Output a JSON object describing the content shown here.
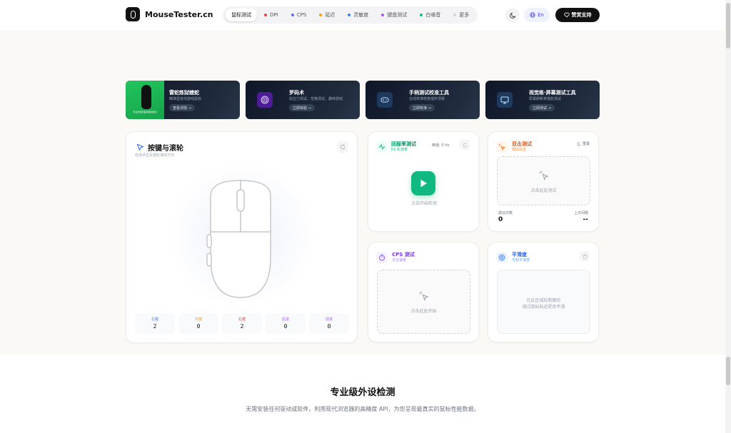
{
  "header": {
    "logo_text": "MouseTester.cn",
    "nav": [
      {
        "label": "鼠标测试",
        "dot": ""
      },
      {
        "label": "DPI",
        "dot": "#ef4444"
      },
      {
        "label": "CPS",
        "dot": "#6366f1"
      },
      {
        "label": "延迟",
        "dot": "#f59e0b"
      },
      {
        "label": "灵敏度",
        "dot": "#3b82f6"
      },
      {
        "label": "键盘测试",
        "dot": "#a855f7"
      },
      {
        "label": "白噪音",
        "dot": "#10b981"
      },
      {
        "label": "更多",
        "dot": "#d1d5db"
      }
    ],
    "lang_label": "En",
    "donate_label": "赞赏支持"
  },
  "promos": [
    {
      "title": "雷蛇炼狱蝰蛇",
      "sub": "精准型有线游戏鼠标",
      "btn": "查看详情 →",
      "caption": "专业玩家的首选游戏鼠标"
    },
    {
      "title": "罗码术",
      "sub": "反应力测试、性格测试、趣味游戏",
      "btn": "立即体验 →",
      "icon": "target-icon"
    },
    {
      "title": "手柄测试校准工具",
      "sub": "在线校准修复摇杆漂移",
      "btn": "立即校准 →",
      "icon": "gamepad-icon"
    },
    {
      "title": "视觉练·屏幕测试工具",
      "sub": "屏幕刷新率拖影测试",
      "btn": "立即测试 →",
      "icon": "monitor-icon"
    }
  ],
  "buttons_card": {
    "title": "按键与滚轮",
    "sub": "检测点击及滚轮滚动方向",
    "stats": [
      {
        "label": "左键",
        "value": "2",
        "color": "#3b82f6"
      },
      {
        "label": "中键",
        "value": "0",
        "color": "#f59e0b"
      },
      {
        "label": "右键",
        "value": "2",
        "color": "#ef4444"
      },
      {
        "label": "后退",
        "value": "0",
        "color": "#a855f7"
      },
      {
        "label": "前进",
        "value": "0",
        "color": "#a855f7"
      }
    ]
  },
  "polling_card": {
    "title": "回报率测试",
    "sub": "Hz 轮询率",
    "peak": "峰值: 0 Hz",
    "hint": "点击开始检测"
  },
  "double_click_card": {
    "title": "双击测试",
    "sub": "模拟双击",
    "reset": "重置",
    "area_hint": "点击此处测试",
    "success_label": "成功次数",
    "success_value": "0",
    "interval_label": "上次间隔",
    "interval_value": "--"
  },
  "cps_card": {
    "title": "CPS 测试",
    "sub": "点击速度",
    "area_hint": "点击此处开始"
  },
  "smooth_card": {
    "title": "平滑度",
    "sub": "光标平滑度",
    "area_hint_1": "在此区域绘制图形",
    "area_hint_2": "测试鼠标轨迹是否平滑"
  },
  "section": {
    "title": "专业级外设检测",
    "desc": "无需安装任何驱动或软件。利用现代浏览器的高精度 API，为您呈现最真实的鼠标性能数据。"
  }
}
